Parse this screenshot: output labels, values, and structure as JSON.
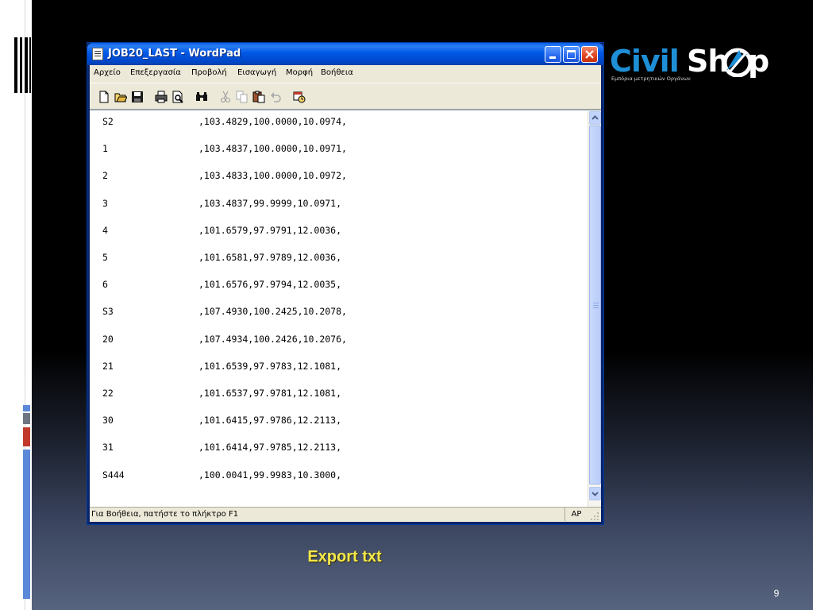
{
  "window": {
    "title": "JOB20_LAST - WordPad",
    "menu": [
      "Αρχείο",
      "Επεξεργασία",
      "Προβολή",
      "Εισαγωγή",
      "Μορφή",
      "Βοήθεια"
    ],
    "status_text": "Για Βοήθεια, πατήστε το πλήκτρο F1",
    "status_mode": "AP"
  },
  "document": {
    "rows": [
      {
        "id": "S2",
        "values": ",103.4829,100.0000,10.0974,"
      },
      {
        "id": "1",
        "values": ",103.4837,100.0000,10.0971,"
      },
      {
        "id": "2",
        "values": ",103.4833,100.0000,10.0972,"
      },
      {
        "id": "3",
        "values": ",103.4837,99.9999,10.0971,"
      },
      {
        "id": "4",
        "values": ",101.6579,97.9791,12.0036,"
      },
      {
        "id": "5",
        "values": ",101.6581,97.9789,12.0036,"
      },
      {
        "id": "6",
        "values": ",101.6576,97.9794,12.0035,"
      },
      {
        "id": "S3",
        "values": ",107.4930,100.2425,10.2078,"
      },
      {
        "id": "20",
        "values": ",107.4934,100.2426,10.2076,"
      },
      {
        "id": "21",
        "values": ",101.6539,97.9783,12.1081,"
      },
      {
        "id": "22",
        "values": ",101.6537,97.9781,12.1081,"
      },
      {
        "id": "30",
        "values": ",101.6415,97.9786,12.2113,"
      },
      {
        "id": "31",
        "values": ",101.6414,97.9785,12.2113,"
      },
      {
        "id": "S444",
        "values": ",100.0041,99.9983,10.3000,"
      }
    ]
  },
  "logo": {
    "civil": "Civil",
    "sh": "Sh",
    "p": "p",
    "subtitle": "Εμπόρια μετρητικών Οργάνων"
  },
  "slide": {
    "caption": "Export txt",
    "page_number": "9"
  },
  "colors": {
    "title_bar": "#0058e6",
    "caption": "#f3e84a",
    "logo_blue": "#1e8fd6"
  }
}
